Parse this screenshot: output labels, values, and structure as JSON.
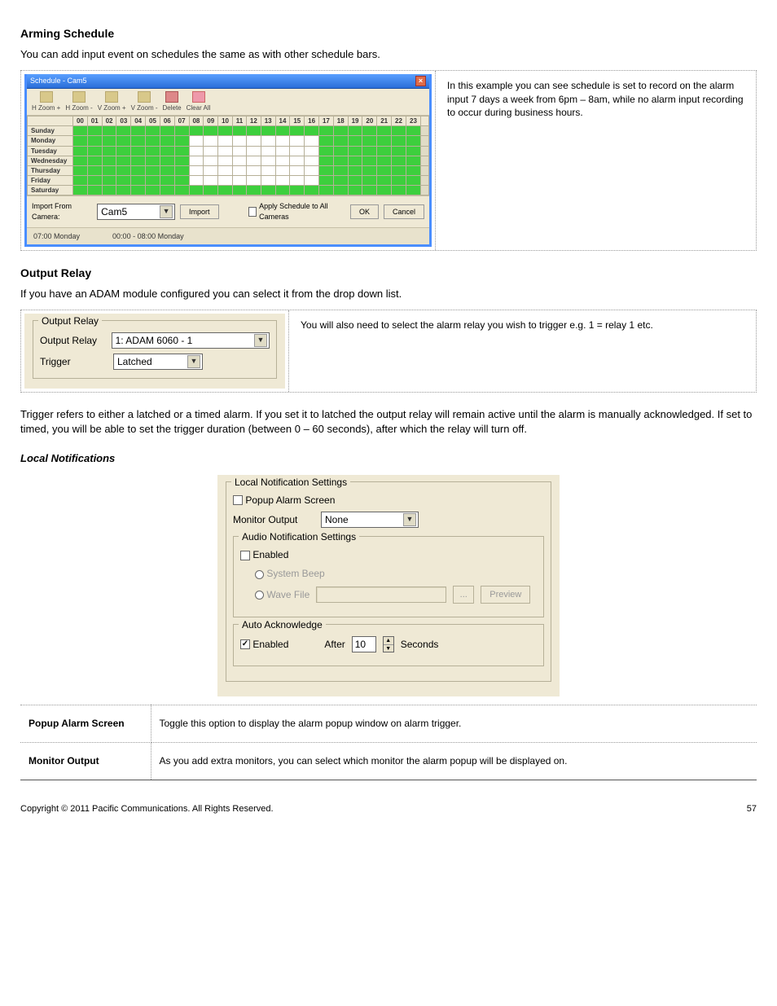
{
  "heading1": "Arming Schedule",
  "body1": "You can add input event on schedules the same as with other schedule bars.",
  "schedule": {
    "title": "Schedule - Cam5",
    "tools": [
      "H Zoom +",
      "H Zoom -",
      "V Zoom +",
      "V Zoom -",
      "Delete",
      "Clear All"
    ],
    "hours": [
      "00",
      "01",
      "02",
      "03",
      "04",
      "05",
      "06",
      "07",
      "08",
      "09",
      "10",
      "11",
      "12",
      "13",
      "14",
      "15",
      "16",
      "17",
      "18",
      "19",
      "20",
      "21",
      "22",
      "23"
    ],
    "days": [
      "Sunday",
      "Monday",
      "Tuesday",
      "Wednesday",
      "Thursday",
      "Friday",
      "Saturday"
    ],
    "white_rows": [
      "Monday",
      "Tuesday",
      "Wednesday",
      "Thursday",
      "Friday"
    ],
    "white_start": 8,
    "white_end": 16,
    "import_label": "Import From Camera:",
    "import_camera": "Cam5",
    "import_btn": "Import",
    "apply_all": "Apply Schedule to All Cameras",
    "ok": "OK",
    "cancel": "Cancel",
    "status_left": "07:00 Monday",
    "status_right": "00:00 - 08:00 Monday"
  },
  "panel1_desc": "In this example you can see schedule is set to record on the alarm input 7 days a week from 6pm – 8am, while no alarm input recording to occur during business hours.",
  "heading2": "Output Relay",
  "body2": "If you have an ADAM module configured you can select it from the drop down list.",
  "relay": {
    "legend": "Output Relay",
    "output_label": "Output Relay",
    "output_value": "1: ADAM 6060 - 1",
    "trigger_label": "Trigger",
    "trigger_value": "Latched"
  },
  "relay_desc": "You will also need to select the alarm relay you wish to trigger e.g. 1 = relay 1 etc.",
  "body3": "Trigger refers to either a latched or a timed alarm. If you set it to latched the output relay will remain active until the alarm is manually acknowledged. If set to timed, you will be able to set the trigger duration (between 0 – 60 seconds), after which the relay will turn off.",
  "heading3": "Local Notifications",
  "lns": {
    "legend1": "Local Notification Settings",
    "popup": "Popup Alarm Screen",
    "monitor_label": "Monitor Output",
    "monitor_value": "None",
    "legend2": "Audio Notification Settings",
    "enabled": "Enabled",
    "system_beep": "System Beep",
    "wave_file": "Wave File",
    "browse": "...",
    "preview": "Preview",
    "legend3": "Auto Acknowledge",
    "after": "After",
    "after_value": "10",
    "seconds": "Seconds"
  },
  "defs": [
    {
      "term": "Popup Alarm Screen",
      "def": "Toggle this option to display the alarm popup window on alarm trigger."
    },
    {
      "term": "Monitor Output",
      "def": "As you add extra monitors, you can select which monitor the alarm popup will be displayed on."
    }
  ],
  "footer_left": "Copyright © 2011 Pacific Communications. All Rights Reserved.",
  "footer_right": "57"
}
